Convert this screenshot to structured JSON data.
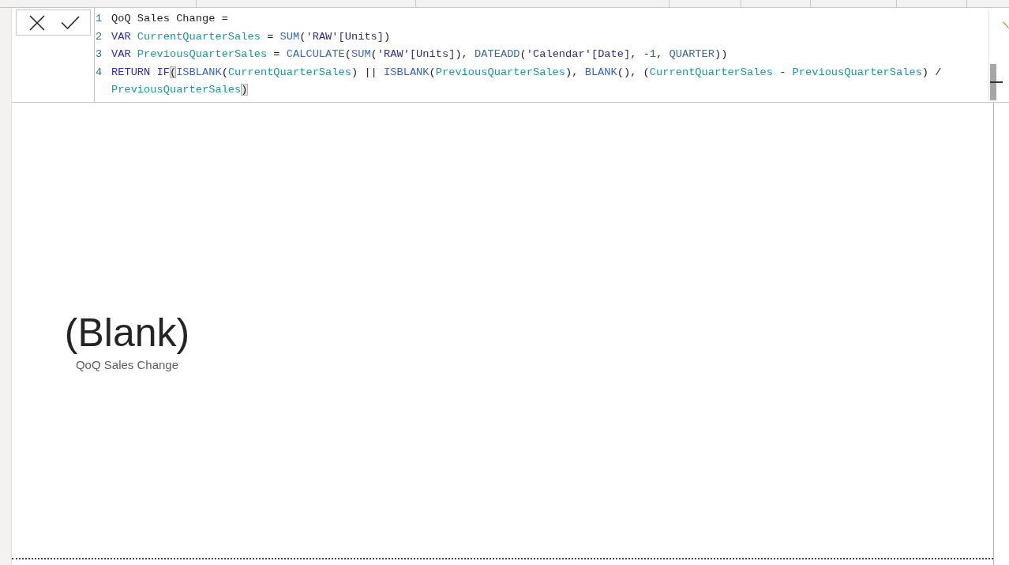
{
  "formula_bar": {
    "lines": [
      {
        "number": "1",
        "tokens": [
          {
            "kind": "plain",
            "text": "QoQ Sales Change ="
          }
        ]
      },
      {
        "number": "2",
        "tokens": [
          {
            "kind": "keyword",
            "text": "VAR "
          },
          {
            "kind": "variable",
            "text": "CurrentQuarterSales"
          },
          {
            "kind": "plain",
            "text": " = "
          },
          {
            "kind": "function",
            "text": "SUM"
          },
          {
            "kind": "plain",
            "text": "("
          },
          {
            "kind": "table",
            "text": "'RAW'[Units]"
          },
          {
            "kind": "plain",
            "text": ")"
          }
        ]
      },
      {
        "number": "3",
        "tokens": [
          {
            "kind": "keyword",
            "text": "VAR "
          },
          {
            "kind": "variable",
            "text": "PreviousQuarterSales"
          },
          {
            "kind": "plain",
            "text": " = "
          },
          {
            "kind": "function",
            "text": "CALCULATE"
          },
          {
            "kind": "plain",
            "text": "("
          },
          {
            "kind": "function",
            "text": "SUM"
          },
          {
            "kind": "plain",
            "text": "("
          },
          {
            "kind": "table",
            "text": "'RAW'[Units]"
          },
          {
            "kind": "plain",
            "text": "), "
          },
          {
            "kind": "function",
            "text": "DATEADD"
          },
          {
            "kind": "plain",
            "text": "("
          },
          {
            "kind": "table",
            "text": "'Calendar'[Date]"
          },
          {
            "kind": "plain",
            "text": ", -"
          },
          {
            "kind": "number",
            "text": "1"
          },
          {
            "kind": "plain",
            "text": ", "
          },
          {
            "kind": "constant",
            "text": "QUARTER"
          },
          {
            "kind": "plain",
            "text": "))"
          }
        ]
      },
      {
        "number": "4",
        "tokens": [
          {
            "kind": "keyword",
            "text": "RETURN IF"
          },
          {
            "kind": "bracket_match",
            "text": "("
          },
          {
            "kind": "function",
            "text": "ISBLANK"
          },
          {
            "kind": "plain",
            "text": "("
          },
          {
            "kind": "variable",
            "text": "CurrentQuarterSales"
          },
          {
            "kind": "plain",
            "text": ") || "
          },
          {
            "kind": "function",
            "text": "ISBLANK"
          },
          {
            "kind": "plain",
            "text": "("
          },
          {
            "kind": "variable",
            "text": "PreviousQuarterSales"
          },
          {
            "kind": "plain",
            "text": "), "
          },
          {
            "kind": "function",
            "text": "BLANK"
          },
          {
            "kind": "plain",
            "text": "(), ("
          },
          {
            "kind": "variable",
            "text": "CurrentQuarterSales"
          },
          {
            "kind": "plain",
            "text": " - "
          },
          {
            "kind": "variable",
            "text": "PreviousQuarterSales"
          },
          {
            "kind": "plain",
            "text": ") / "
          },
          {
            "kind": "variable",
            "text": "PreviousQuarterSales"
          },
          {
            "kind": "bracket_match",
            "text": ")"
          }
        ]
      }
    ]
  },
  "card": {
    "value": "(Blank)",
    "label": "QoQ Sales Change"
  }
}
